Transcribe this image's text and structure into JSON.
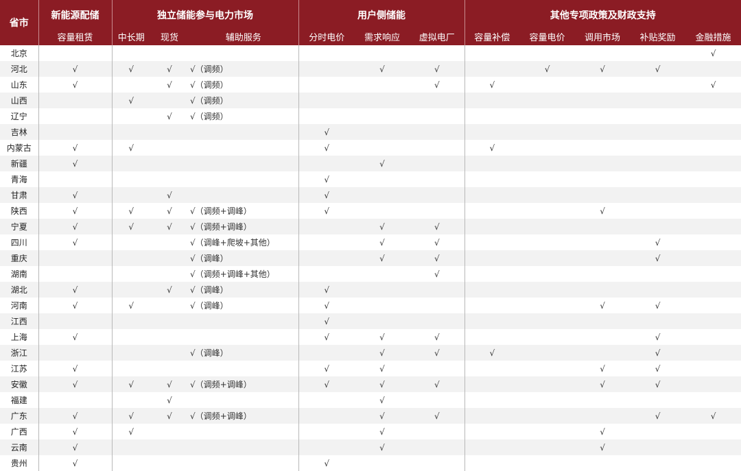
{
  "header": {
    "province": "省市",
    "groups": [
      "新能源配储",
      "独立储能参与电力市场",
      "用户侧储能",
      "其他专项政策及财政支持"
    ],
    "columns": [
      "容量租赁",
      "中长期",
      "现货",
      "辅助服务",
      "分时电价",
      "需求响应",
      "虚拟电厂",
      "容量补偿",
      "容量电价",
      "调用市场",
      "补贴奖励",
      "金融措施"
    ]
  },
  "rows": [
    {
      "p": "北京",
      "c": [
        "",
        "",
        "",
        "",
        "",
        "",
        "",
        "",
        "",
        "",
        "",
        "√"
      ]
    },
    {
      "p": "河北",
      "c": [
        "√",
        "√",
        "√",
        "√（调频）",
        "",
        "√",
        "√",
        "",
        "√",
        "√",
        "√",
        ""
      ]
    },
    {
      "p": "山东",
      "c": [
        "√",
        "",
        "√",
        "√（调频）",
        "",
        "",
        "√",
        "√",
        "",
        "",
        "",
        "√"
      ]
    },
    {
      "p": "山西",
      "c": [
        "",
        "√",
        "",
        "√（调频）",
        "",
        "",
        "",
        "",
        "",
        "",
        "",
        ""
      ]
    },
    {
      "p": "辽宁",
      "c": [
        "",
        "",
        "√",
        "√（调频）",
        "",
        "",
        "",
        "",
        "",
        "",
        "",
        ""
      ]
    },
    {
      "p": "吉林",
      "c": [
        "",
        "",
        "",
        "",
        "√",
        "",
        "",
        "",
        "",
        "",
        "",
        ""
      ]
    },
    {
      "p": "内蒙古",
      "c": [
        "√",
        "√",
        "",
        "",
        "√",
        "",
        "",
        "√",
        "",
        "",
        "",
        ""
      ]
    },
    {
      "p": "新疆",
      "c": [
        "√",
        "",
        "",
        "",
        "",
        "√",
        "",
        "",
        "",
        "",
        "",
        ""
      ]
    },
    {
      "p": "青海",
      "c": [
        "",
        "",
        "",
        "",
        "√",
        "",
        "",
        "",
        "",
        "",
        "",
        ""
      ]
    },
    {
      "p": "甘肃",
      "c": [
        "√",
        "",
        "√",
        "",
        "√",
        "",
        "",
        "",
        "",
        "",
        "",
        ""
      ]
    },
    {
      "p": "陕西",
      "c": [
        "√",
        "√",
        "√",
        "√（调频+调峰）",
        "√",
        "",
        "",
        "",
        "",
        "√",
        "",
        ""
      ]
    },
    {
      "p": "宁夏",
      "c": [
        "√",
        "√",
        "√",
        "√（调频+调峰）",
        "",
        "√",
        "√",
        "",
        "",
        "",
        "",
        ""
      ]
    },
    {
      "p": "四川",
      "c": [
        "√",
        "",
        "",
        "√（调峰+爬坡+其他）",
        "",
        "√",
        "√",
        "",
        "",
        "",
        "√",
        ""
      ]
    },
    {
      "p": "重庆",
      "c": [
        "",
        "",
        "",
        "√（调峰）",
        "",
        "√",
        "√",
        "",
        "",
        "",
        "√",
        ""
      ]
    },
    {
      "p": "湖南",
      "c": [
        "",
        "",
        "",
        "√（调频+调峰+其他）",
        "",
        "",
        "√",
        "",
        "",
        "",
        "",
        ""
      ]
    },
    {
      "p": "湖北",
      "c": [
        "√",
        "",
        "√",
        "√（调峰）",
        "√",
        "",
        "",
        "",
        "",
        "",
        "",
        ""
      ]
    },
    {
      "p": "河南",
      "c": [
        "√",
        "√",
        "",
        "√（调峰）",
        "√",
        "",
        "",
        "",
        "",
        "√",
        "√",
        ""
      ]
    },
    {
      "p": "江西",
      "c": [
        "",
        "",
        "",
        "",
        "√",
        "",
        "",
        "",
        "",
        "",
        "",
        ""
      ]
    },
    {
      "p": "上海",
      "c": [
        "√",
        "",
        "",
        "",
        "√",
        "√",
        "√",
        "",
        "",
        "",
        "√",
        ""
      ]
    },
    {
      "p": "浙江",
      "c": [
        "",
        "",
        "",
        "√（调峰）",
        "",
        "√",
        "√",
        "√",
        "",
        "",
        "√",
        ""
      ]
    },
    {
      "p": "江苏",
      "c": [
        "√",
        "",
        "",
        "",
        "√",
        "√",
        "",
        "",
        "",
        "√",
        "√",
        ""
      ]
    },
    {
      "p": "安徽",
      "c": [
        "√",
        "√",
        "√",
        "√（调频+调峰）",
        "√",
        "√",
        "√",
        "",
        "",
        "√",
        "√",
        ""
      ]
    },
    {
      "p": "福建",
      "c": [
        "",
        "",
        "√",
        "",
        "",
        "√",
        "",
        "",
        "",
        "",
        "",
        ""
      ]
    },
    {
      "p": "广东",
      "c": [
        "√",
        "√",
        "√",
        "√（调频+调峰）",
        "",
        "√",
        "√",
        "",
        "",
        "",
        "√",
        "√"
      ]
    },
    {
      "p": "广西",
      "c": [
        "√",
        "√",
        "",
        "",
        "",
        "√",
        "",
        "",
        "",
        "√",
        "",
        ""
      ]
    },
    {
      "p": "云南",
      "c": [
        "√",
        "",
        "",
        "",
        "",
        "√",
        "",
        "",
        "",
        "√",
        "",
        ""
      ]
    },
    {
      "p": "贵州",
      "c": [
        "√",
        "",
        "",
        "",
        "√",
        "",
        "",
        "",
        "",
        "",
        "",
        ""
      ]
    }
  ]
}
